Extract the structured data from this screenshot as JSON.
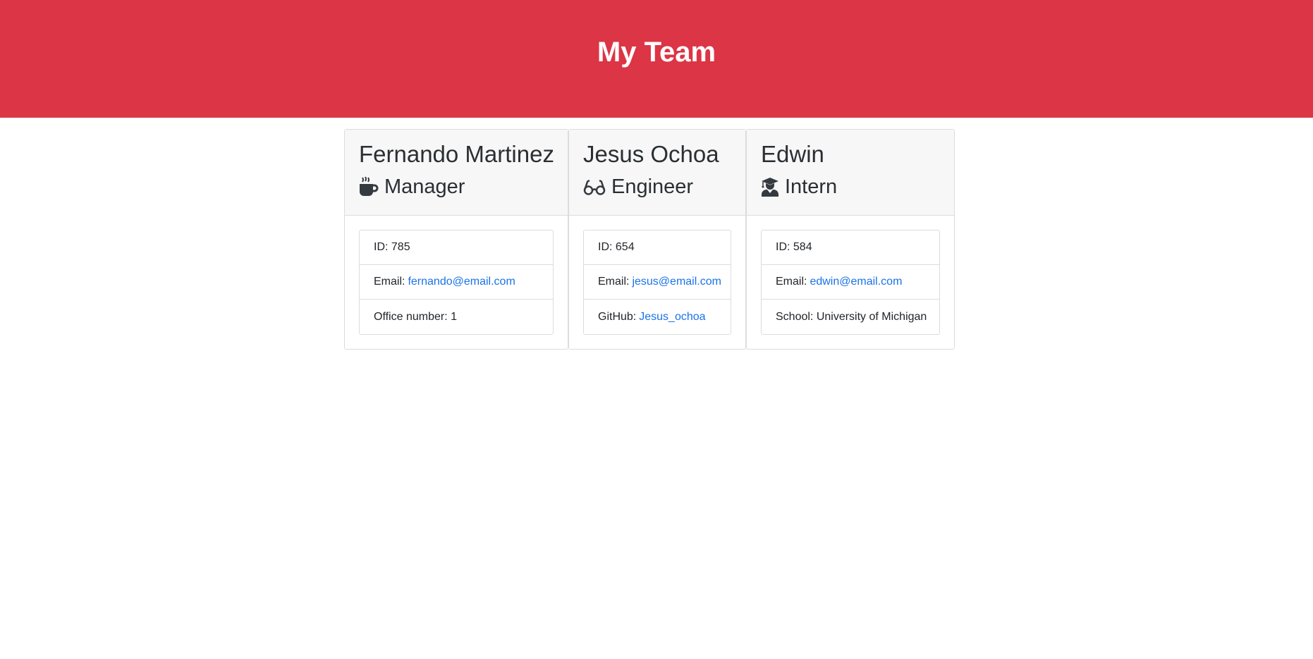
{
  "header": {
    "title": "My Team"
  },
  "colors": {
    "header_bg": "#dc3545",
    "link": "#1a73e8"
  },
  "team": [
    {
      "name": "Fernando Martinez",
      "role": "Manager",
      "icon": "mug-icon",
      "id_label": "ID: 785",
      "email_prefix": "Email:",
      "email": "fernando@email.com",
      "extra_prefix": "Office number: 1",
      "extra_link": ""
    },
    {
      "name": "Jesus Ochoa",
      "role": "Engineer",
      "icon": "glasses-icon",
      "id_label": "ID: 654",
      "email_prefix": "Email:",
      "email": "jesus@email.com",
      "extra_prefix": "GitHub:",
      "extra_link": "Jesus_ochoa"
    },
    {
      "name": "Edwin",
      "role": "Intern",
      "icon": "graduate-icon",
      "id_label": "ID: 584",
      "email_prefix": "Email:",
      "email": "edwin@email.com",
      "extra_prefix": "School: University of Michigan",
      "extra_link": ""
    }
  ]
}
